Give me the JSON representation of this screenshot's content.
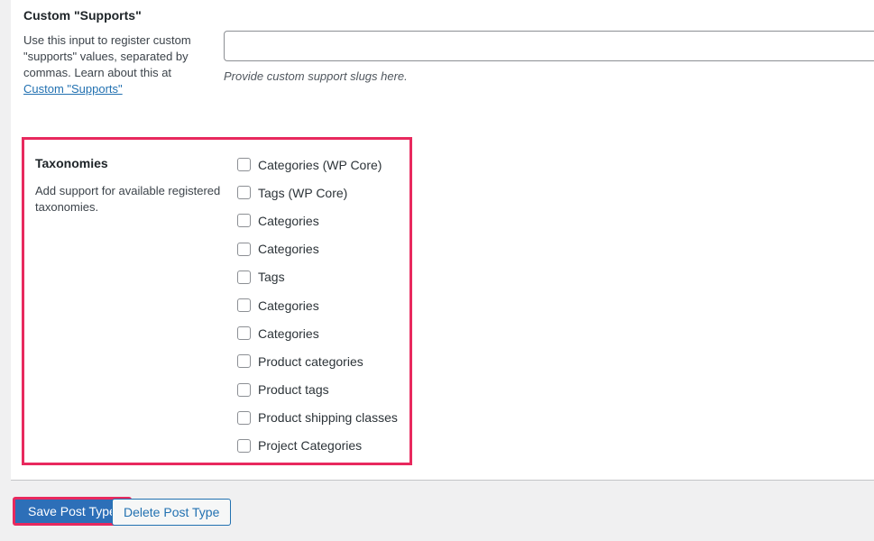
{
  "supports_section": {
    "title": "Custom \"Supports\"",
    "description_before_link": "Use this input to register custom \"supports\" values, separated by commas. Learn about this at ",
    "link_text": "Custom \"Supports\"",
    "input_value": "",
    "input_placeholder": "",
    "input_hint": "Provide custom support slugs here."
  },
  "taxonomies_section": {
    "title": "Taxonomies",
    "description": "Add support for available registered taxonomies.",
    "highlight_color": "#e8295e",
    "items": [
      {
        "label": "Categories (WP Core)",
        "checked": false
      },
      {
        "label": "Tags (WP Core)",
        "checked": false
      },
      {
        "label": "Categories",
        "checked": false
      },
      {
        "label": "Categories",
        "checked": false
      },
      {
        "label": "Tags",
        "checked": false
      },
      {
        "label": "Categories",
        "checked": false
      },
      {
        "label": "Categories",
        "checked": false
      },
      {
        "label": "Product categories",
        "checked": false
      },
      {
        "label": "Product tags",
        "checked": false
      },
      {
        "label": "Product shipping classes",
        "checked": false
      },
      {
        "label": "Project Categories",
        "checked": false
      }
    ]
  },
  "footer": {
    "save_label": "Save Post Type",
    "delete_label": "Delete Post Type",
    "save_bg": "#2d6fb8",
    "save_highlight": "#e8295e",
    "delete_border": "#2271b1",
    "delete_text_color": "#2271b1"
  }
}
